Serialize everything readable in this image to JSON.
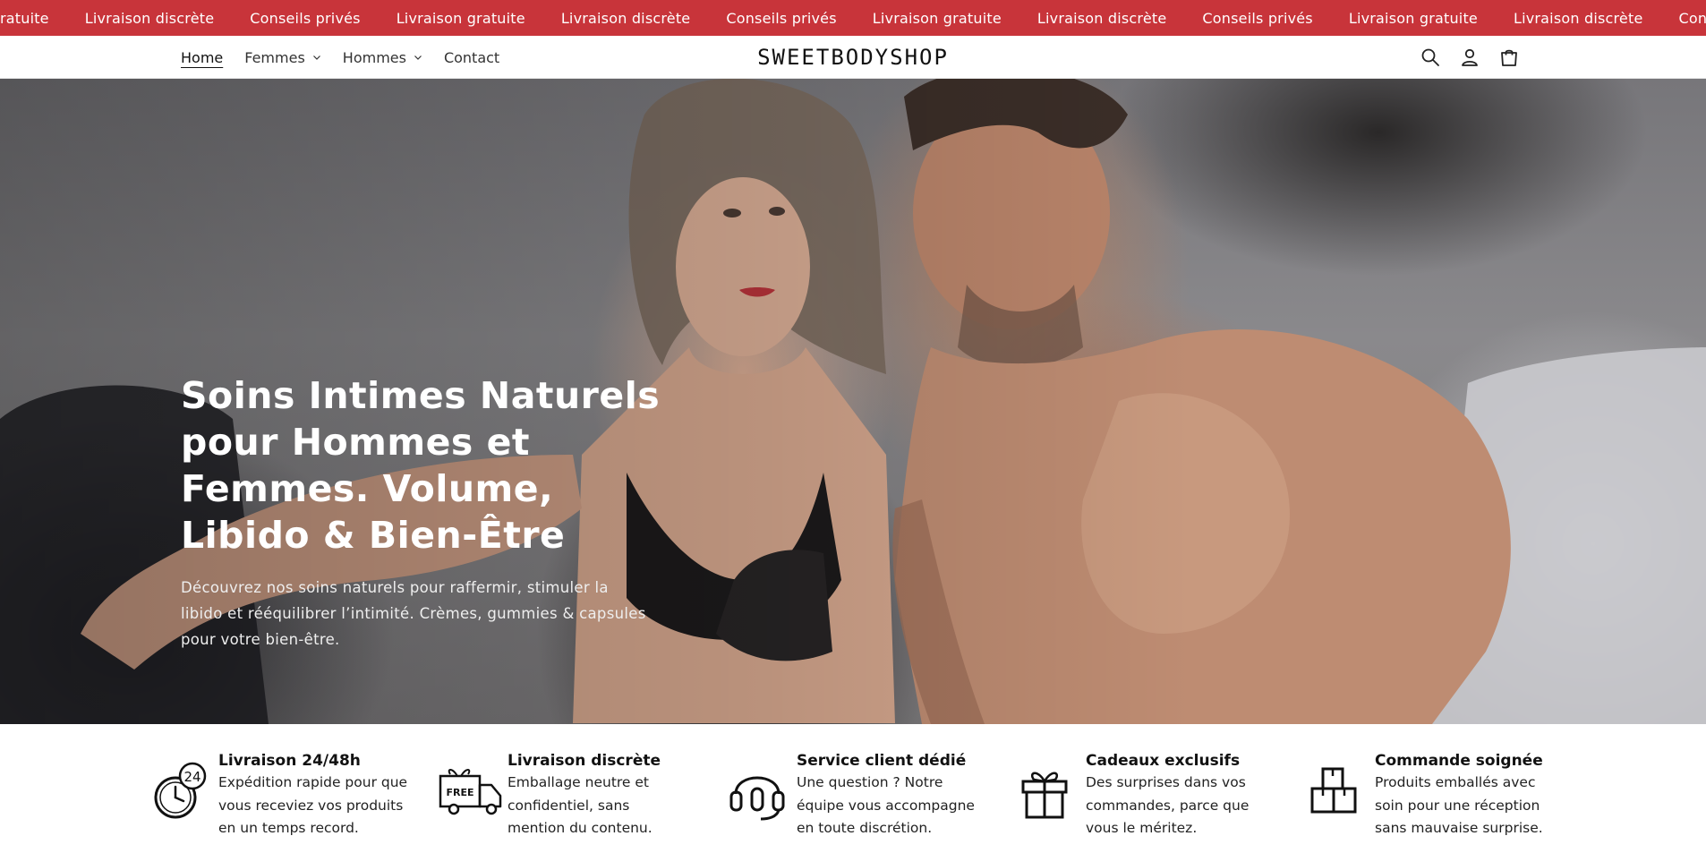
{
  "announcements": [
    "on gratuite",
    "Livraison discrète",
    "Conseils privés",
    "Livraison gratuite",
    "Livraison discrète",
    "Conseils privés",
    "Livraison gratuite",
    "Livraison discrète",
    "Conseils privés",
    "Livraison gratuite",
    "Livraison discrète",
    "Conseils privés"
  ],
  "nav": {
    "home": "Home",
    "femmes": "Femmes",
    "hommes": "Hommes",
    "contact": "Contact"
  },
  "logo": "SWEETBODYSHOP",
  "icons": {
    "search": "search-icon",
    "account": "account-icon",
    "cart": "cart-icon"
  },
  "hero": {
    "title": "Soins Intimes Naturels pour Hommes et Femmes. Volume, Libido & Bien-Être",
    "subtitle": "Découvrez nos soins naturels pour raffermir, stimuler la libido et rééquilibrer l’intimité. Crèmes, gummies & capsules pour votre bien-être."
  },
  "features": [
    {
      "title": "Livraison 24/48h",
      "desc": "Expédition rapide pour que vous receviez vos produits en un temps record.",
      "icon": "clock-24-icon",
      "badge": "24"
    },
    {
      "title": "Livraison discrète",
      "desc": "Emballage neutre et confidentiel, sans mention du contenu.",
      "icon": "free-truck-icon",
      "badge": "FREE"
    },
    {
      "title": "Service client dédié",
      "desc": "Une question ? Notre équipe vous accompagne en toute discrétion.",
      "icon": "headset-icon"
    },
    {
      "title": "Cadeaux exclusifs",
      "desc": "Des surprises dans vos commandes, parce que vous le méritez.",
      "icon": "gift-icon"
    },
    {
      "title": "Commande soignée",
      "desc": "Produits emballés avec soin pour une réception sans mauvaise surprise.",
      "icon": "boxes-icon"
    }
  ],
  "colors": {
    "topbar": "#c8343a",
    "text": "#111111"
  }
}
